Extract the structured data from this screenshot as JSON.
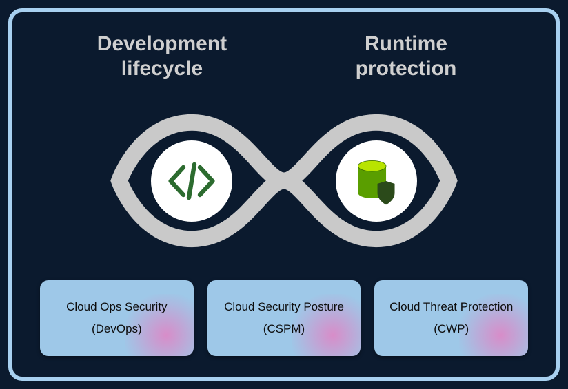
{
  "headings": {
    "left": "Development lifecycle",
    "right": "Runtime protection"
  },
  "icons": {
    "left": "code-icon",
    "right": "database-shield-icon"
  },
  "cards": [
    {
      "title": "Cloud Ops Security",
      "sub": "(DevOps)"
    },
    {
      "title": "Cloud Security Posture",
      "sub": "(CSPM)"
    },
    {
      "title": "Cloud Threat Protection",
      "sub": "(CWP)"
    }
  ],
  "colors": {
    "frame_border": "#a8d0f0",
    "background": "#0b1a2e",
    "card_bg": "#9ec8e8",
    "infinity_stroke": "#c9c9c9",
    "code_green": "#2c6b2f",
    "db_green": "#5a9e00",
    "db_lime": "#b8e400"
  }
}
